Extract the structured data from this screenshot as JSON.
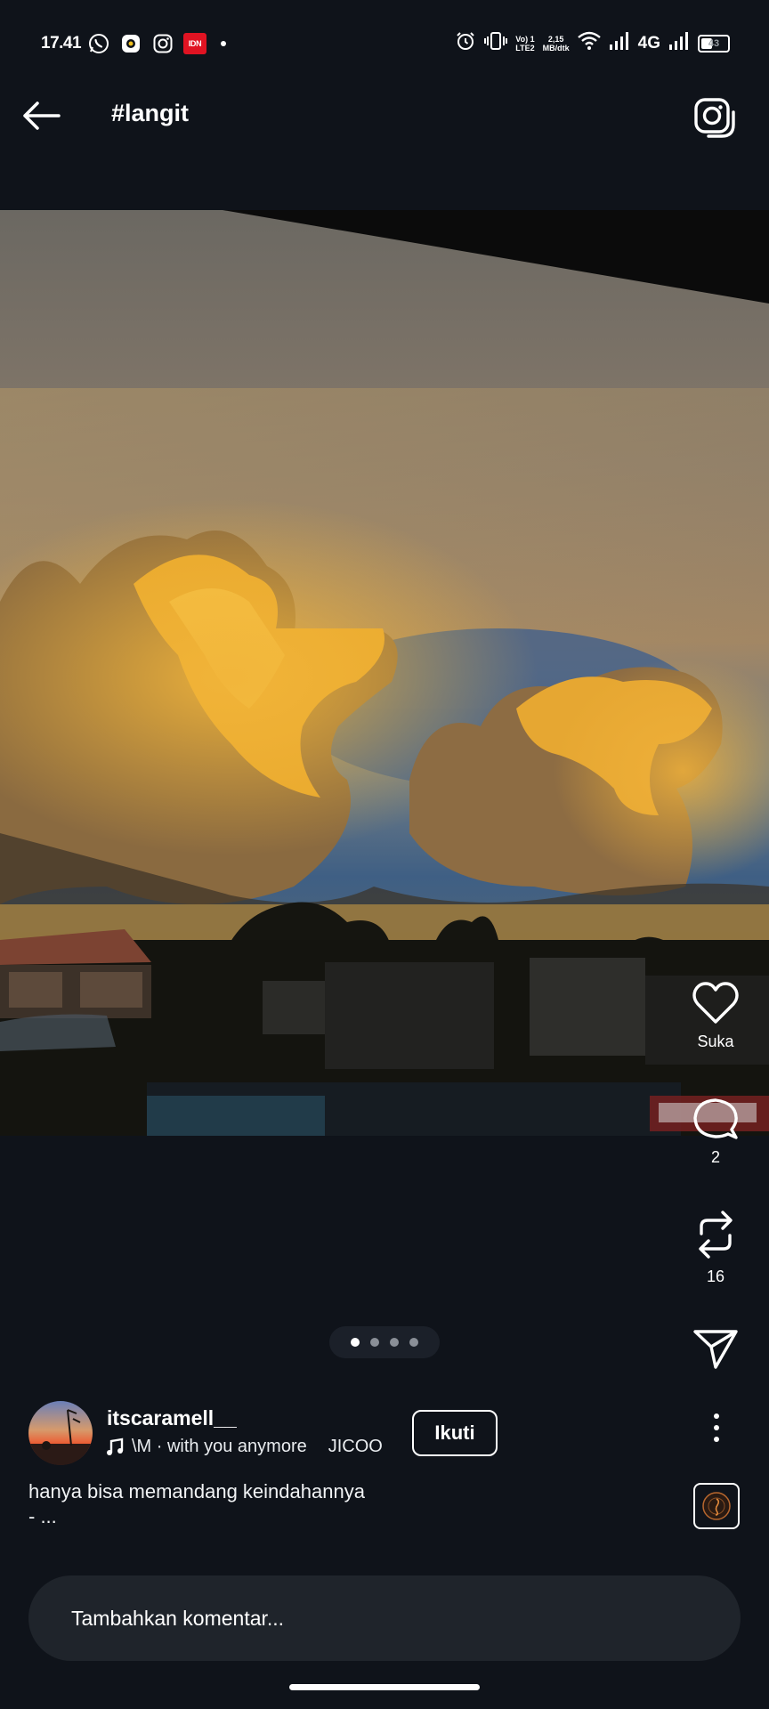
{
  "status_bar": {
    "time": "17.41",
    "apps": [
      "whatsapp-icon",
      "camera-app-icon",
      "instagram-icon",
      "idn-icon"
    ],
    "idn_label": "IDN",
    "volte_line1": "Vo) 1",
    "volte_line2": "LTE2",
    "speed_line1": "2,15",
    "speed_line2": "MB/dtk",
    "network": "4G",
    "battery": "43"
  },
  "header": {
    "title": "#langit"
  },
  "post": {
    "pager": {
      "count": 4,
      "active_index": 0
    },
    "author": {
      "username": "itscaramell__",
      "song": "\\M · with you anymore",
      "artist": "JICOO"
    },
    "follow_label": "Ikuti",
    "caption_line1": "hanya bisa memandang keindahannya",
    "caption_line2": "- ..."
  },
  "actions": {
    "like_label": "Suka",
    "comments_count": "2",
    "reposts_count": "16"
  },
  "comment": {
    "placeholder": "Tambahkan komentar..."
  },
  "colors": {
    "background": "#0f131a",
    "pill": "#1f242b",
    "idn_red": "#e01322"
  }
}
